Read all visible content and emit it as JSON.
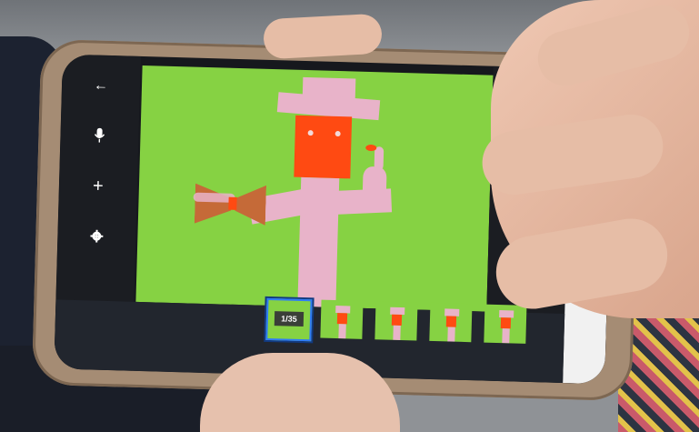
{
  "app": {
    "left_toolbar": {
      "back_icon": "arrow-left",
      "mic_icon": "microphone",
      "add_icon": "plus",
      "settings_icon": "gear"
    },
    "right_toolbar": {
      "help_label": "?"
    },
    "frame_strip": {
      "frame_counter": "1/35",
      "selected_frame": 1,
      "total_frames": 35
    }
  },
  "colors": {
    "canvas_background": "#86d243",
    "figure": "#e8b3c9",
    "head": "#ff4a12",
    "selection": "#2f7cf6"
  }
}
